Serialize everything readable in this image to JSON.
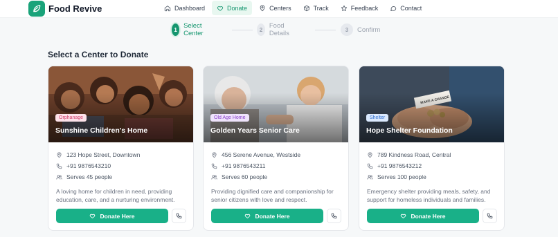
{
  "app": {
    "name": "Food Revive",
    "logo_icon": "leaf-icon"
  },
  "nav": {
    "items": [
      {
        "label": "Dashboard",
        "icon": "home-icon",
        "active": false
      },
      {
        "label": "Donate",
        "icon": "heart-icon",
        "active": true
      },
      {
        "label": "Centers",
        "icon": "map-pin-icon",
        "active": false
      },
      {
        "label": "Track",
        "icon": "package-icon",
        "active": false
      },
      {
        "label": "Feedback",
        "icon": "star-icon",
        "active": false
      },
      {
        "label": "Contact",
        "icon": "message-icon",
        "active": false
      }
    ]
  },
  "stepper": {
    "steps": [
      {
        "num": "1",
        "label": "Select Center",
        "state": "active"
      },
      {
        "num": "2",
        "label": "Food Details",
        "state": "inactive"
      },
      {
        "num": "3",
        "label": "Confirm",
        "state": "inactive"
      }
    ]
  },
  "section": {
    "title": "Select a Center to Donate"
  },
  "colors": {
    "accent": "#15966f",
    "button": "#19b088",
    "tag_orphanage_bg": "#fde2ea",
    "tag_orphanage_fg": "#d33f6c",
    "tag_oldage_bg": "#efe3fb",
    "tag_oldage_fg": "#8a42c9",
    "tag_shelter_bg": "#dbeafe",
    "tag_shelter_fg": "#2f6fd1"
  },
  "centers": [
    {
      "tag": "Orphanage",
      "name": "Sunshine Children's Home",
      "address": "123 Hope Street, Downtown",
      "phone": "+91 9876543210",
      "serves": "Serves 45 people",
      "description": "A loving home for children in need, providing education, care, and a nurturing environment.",
      "donate_label": "Donate Here"
    },
    {
      "tag": "Old Age Home",
      "name": "Golden Years Senior Care",
      "address": "456 Serene Avenue, Westside",
      "phone": "+91 9876543211",
      "serves": "Serves 60 people",
      "description": "Providing dignified care and companionship for senior citizens with love and respect.",
      "donate_label": "Donate Here"
    },
    {
      "tag": "Shelter",
      "name": "Hope Shelter Foundation",
      "address": "789 Kindness Road, Central",
      "phone": "+91 9876543212",
      "serves": "Serves 100 people",
      "description": "Emergency shelter providing meals, safety, and support for homeless individuals and families.",
      "donate_label": "Donate Here",
      "photo_sign_text": "MAKE A CHANGE"
    }
  ]
}
